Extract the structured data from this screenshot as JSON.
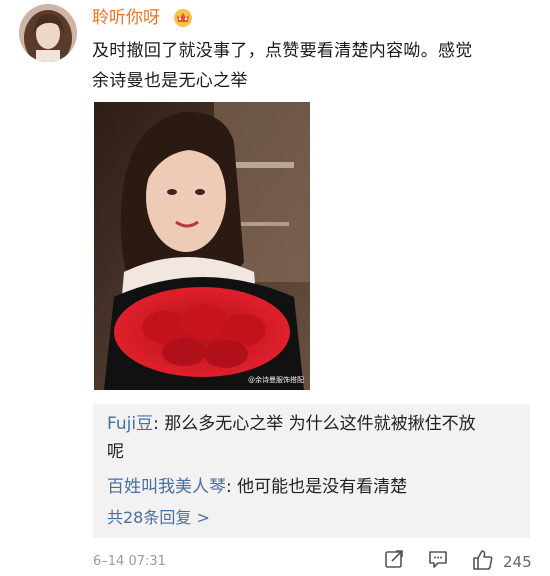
{
  "post": {
    "username": "聆听你呀",
    "text_line1": "及时撤回了就没事了，点赞要看清楚内容呦。感觉",
    "text_line2": "余诗曼也是无心之举",
    "image_watermark": "@余诗曼服饰搭配",
    "timestamp": "6–14 07:31",
    "like_count": "245"
  },
  "comments": {
    "items": [
      {
        "user": "Fuji豆",
        "sep": ": ",
        "line1": "那么多无心之举 为什么这件就被揪住不放",
        "line2": "呢"
      },
      {
        "user": "百姓叫我美人琴",
        "sep": ": ",
        "text": "他可能也是没有看清楚"
      }
    ],
    "more_label": "共28条回复 >"
  },
  "icons": {
    "avatar": "user-avatar",
    "badge": "vip-crown-badge-icon",
    "share": "share-icon",
    "comment": "comment-icon",
    "like": "thumbs-up-icon"
  },
  "colors": {
    "username": "#e8752a",
    "link": "#4a6fa0",
    "comment_bg": "#f2f2f2",
    "meta": "#9a9a9a"
  }
}
